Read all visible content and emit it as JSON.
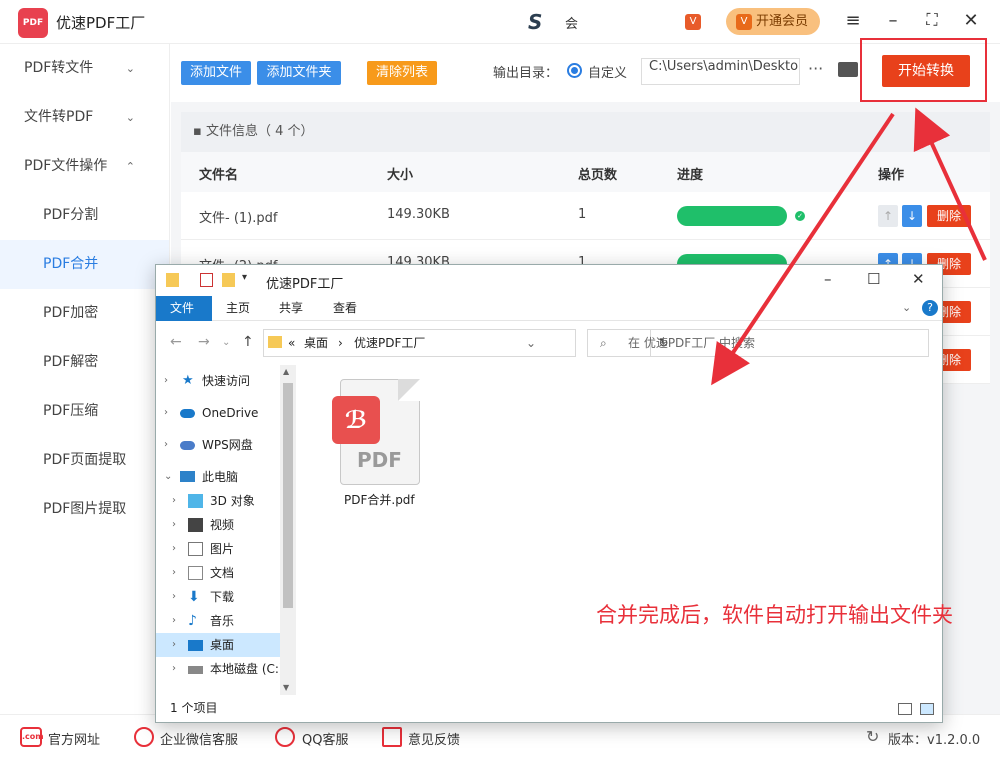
{
  "app": {
    "logo_text": "PDF",
    "title": "优速PDF工厂",
    "user_logo": "S",
    "user_name": "会",
    "vip_label": "开通会员",
    "vip_crown": "V"
  },
  "sidebar": {
    "items": [
      {
        "label": "PDF转文件",
        "chevron": "⌄"
      },
      {
        "label": "文件转PDF",
        "chevron": "⌄"
      },
      {
        "label": "PDF文件操作",
        "chevron": "⌃"
      },
      {
        "label": "PDF分割"
      },
      {
        "label": "PDF合并"
      },
      {
        "label": "PDF加密"
      },
      {
        "label": "PDF解密"
      },
      {
        "label": "PDF压缩"
      },
      {
        "label": "PDF页面提取"
      },
      {
        "label": "PDF图片提取"
      }
    ]
  },
  "toolbar": {
    "add_file": "添加文件",
    "add_folder": "添加文件夹",
    "clear_list": "清除列表",
    "output_label": "输出目录：",
    "radio_custom": "自定义",
    "output_path": "C:\\Users\\admin\\Deskto",
    "more": "···",
    "start": "开始转换"
  },
  "file_table": {
    "info": "文件信息（ 4 个）",
    "headers": {
      "name": "文件名",
      "size": "大小",
      "pages": "总页数",
      "progress": "进度",
      "action": "操作"
    },
    "rows": [
      {
        "name": "文件- (1).pdf",
        "size": "149.30KB",
        "pages": "1",
        "progress": 1.0,
        "delete": "删除"
      },
      {
        "name": "文件- (2).pdf",
        "size": "149.30KB",
        "pages": "1",
        "progress": 1.0,
        "delete": "删除"
      },
      {
        "delete": "删除"
      },
      {
        "delete": "删除"
      }
    ]
  },
  "explorer": {
    "title": "优速PDF工厂",
    "ribbon_tabs": [
      "文件",
      "主页",
      "共享",
      "查看"
    ],
    "address": [
      "«",
      "桌面",
      "›",
      "优速PDF工厂"
    ],
    "search_placeholder": "在 优速PDF工厂 中搜索",
    "tree": [
      {
        "label": "快速访问",
        "icon": "star-icon"
      },
      {
        "label": "OneDrive",
        "icon": "cloud-icon"
      },
      {
        "label": "WPS网盘",
        "icon": "cloud-icon"
      },
      {
        "label": "此电脑",
        "icon": "pc-icon"
      },
      {
        "label": "3D 对象",
        "icon": "cube-icon"
      },
      {
        "label": "视频",
        "icon": "video-icon"
      },
      {
        "label": "图片",
        "icon": "image-icon"
      },
      {
        "label": "文档",
        "icon": "doc-icon"
      },
      {
        "label": "下载",
        "icon": "download-icon"
      },
      {
        "label": "音乐",
        "icon": "music-icon"
      },
      {
        "label": "桌面",
        "icon": "desktop-icon"
      },
      {
        "label": "本地磁盘 (C:)",
        "icon": "disk-icon"
      }
    ],
    "file_name": "PDF合并.pdf",
    "pdf_label": "PDF",
    "status": "1 个项目"
  },
  "annotation": "合并完成后，软件自动打开输出文件夹",
  "bottom": {
    "website": "官方网址",
    "wechat": "企业微信客服",
    "qq": "QQ客服",
    "feedback": "意见反馈",
    "version": "版本：v1.2.0.0",
    "website_icon": ".com"
  },
  "colors": {
    "accent_blue": "#3b8ee8",
    "accent_red": "#e8411b",
    "progress_green": "#1fbf6a",
    "annotation_red": "#e8303a"
  }
}
